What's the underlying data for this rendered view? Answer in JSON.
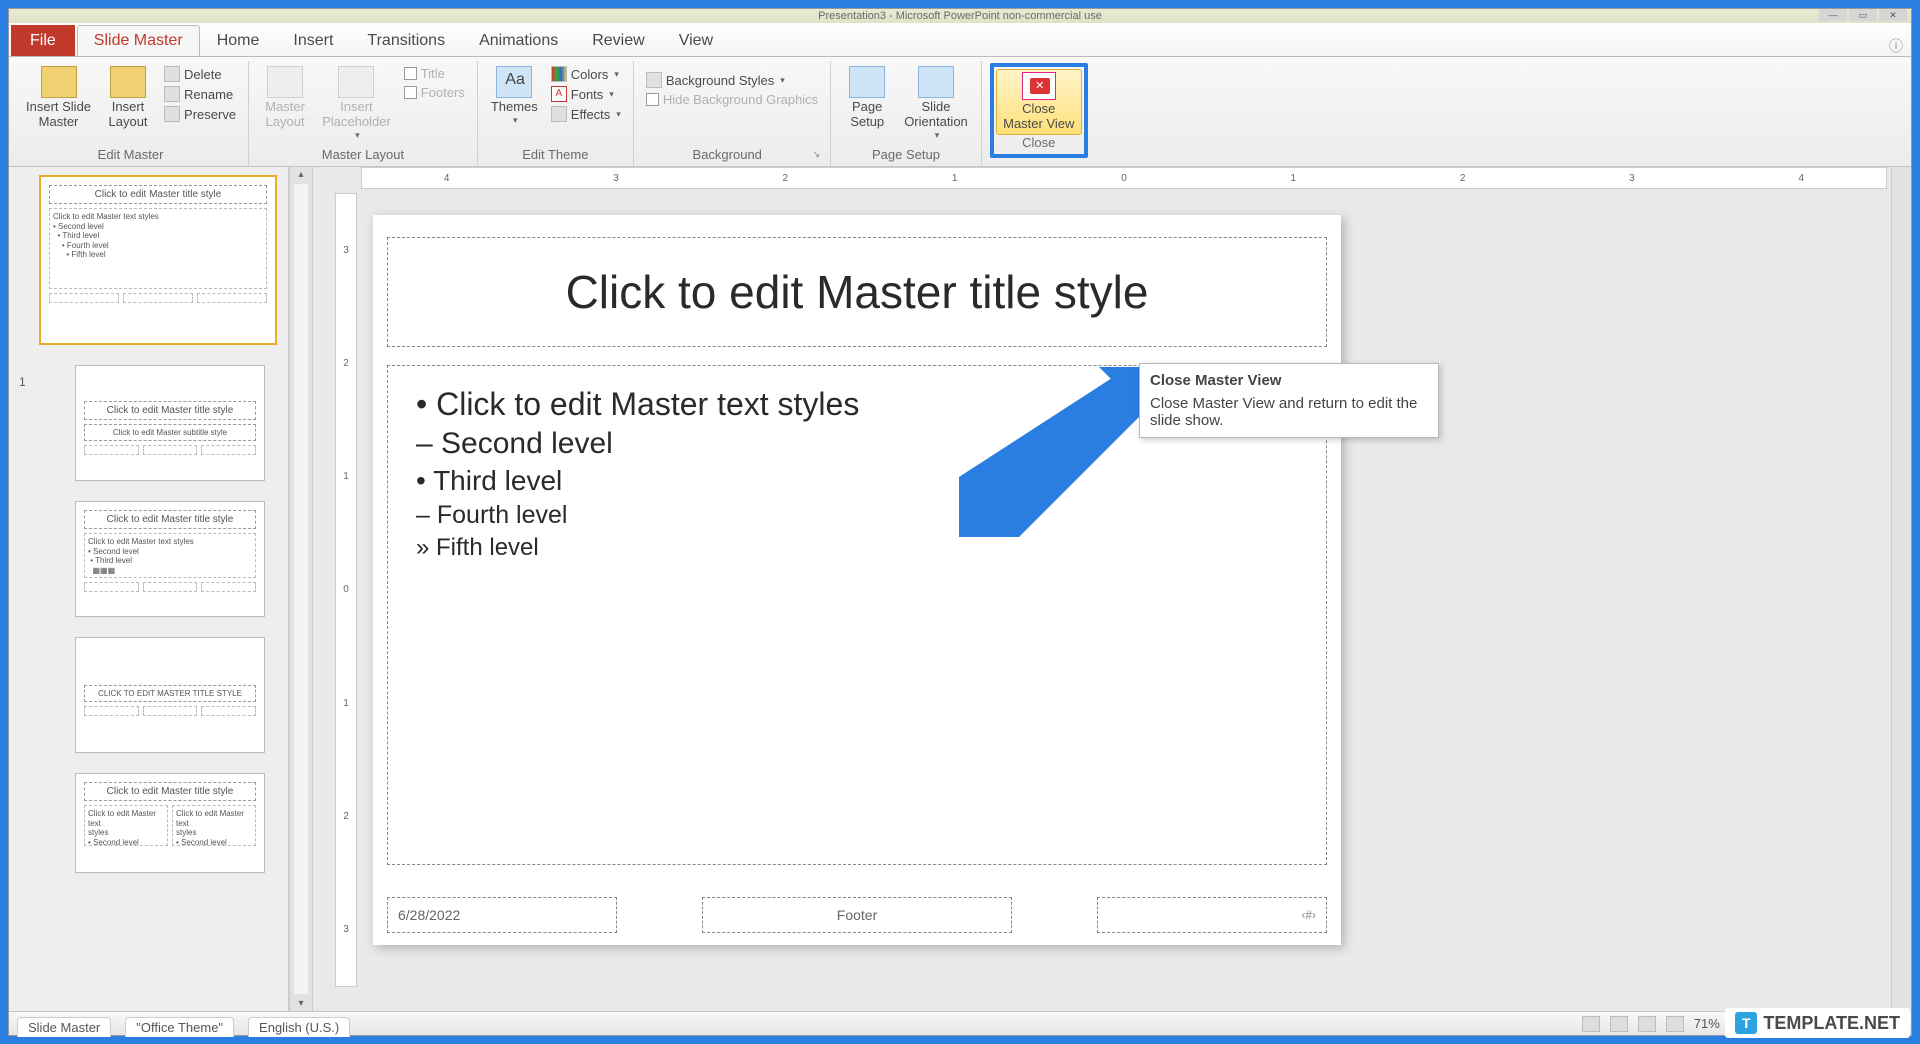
{
  "titlebar": {
    "text": "Presentation3 - Microsoft PowerPoint non-commercial use"
  },
  "tabs": {
    "file": "File",
    "items": [
      "Slide Master",
      "Home",
      "Insert",
      "Transitions",
      "Animations",
      "Review",
      "View"
    ],
    "active": "Slide Master"
  },
  "ribbon": {
    "edit_master": {
      "insert_slide_master": "Insert Slide\nMaster",
      "insert_layout": "Insert\nLayout",
      "delete": "Delete",
      "rename": "Rename",
      "preserve": "Preserve",
      "label": "Edit Master"
    },
    "master_layout": {
      "master_layout": "Master\nLayout",
      "insert_placeholder": "Insert\nPlaceholder",
      "title_chk": "Title",
      "footers_chk": "Footers",
      "label": "Master Layout"
    },
    "edit_theme": {
      "themes": "Themes",
      "colors": "Colors",
      "fonts": "Fonts",
      "effects": "Effects",
      "label": "Edit Theme"
    },
    "background": {
      "bg_styles": "Background Styles",
      "hide_bg": "Hide Background Graphics",
      "label": "Background"
    },
    "page_setup": {
      "page_setup": "Page\nSetup",
      "orientation": "Slide\nOrientation",
      "label": "Page Setup"
    },
    "close": {
      "btn": "Close\nMaster View",
      "label": "Close"
    }
  },
  "tooltip": {
    "title": "Close Master View",
    "body": "Close Master View and return to edit the slide show."
  },
  "ruler_h": [
    "4",
    "3",
    "2",
    "1",
    "0",
    "1",
    "2",
    "3",
    "4"
  ],
  "ruler_v": [
    "3",
    "2",
    "1",
    "0",
    "1",
    "2",
    "3"
  ],
  "slide": {
    "title_ph": "Click to edit Master title style",
    "body1": "Click to edit Master text styles",
    "body2": "Second level",
    "body3": "Third level",
    "body4": "Fourth level",
    "body5": "Fifth level",
    "date": "6/28/2022",
    "footer": "Footer",
    "num": "‹#›"
  },
  "thumbs": {
    "master_title": "Click to edit Master title style",
    "master_sub": "Click to edit Master text styles",
    "layout_title": "Click to edit Master title style",
    "layout_sub": "Click to edit Master subtitle style",
    "layout2_sub": "Click to edit Master text styles",
    "layout3_title": "CLICK TO EDIT MASTER TITLE STYLE"
  },
  "status": {
    "slide_master": "Slide Master",
    "theme": "\"Office Theme\"",
    "lang": "English (U.S.)",
    "zoom": "71%"
  },
  "watermark": "TEMPLATE.NET"
}
